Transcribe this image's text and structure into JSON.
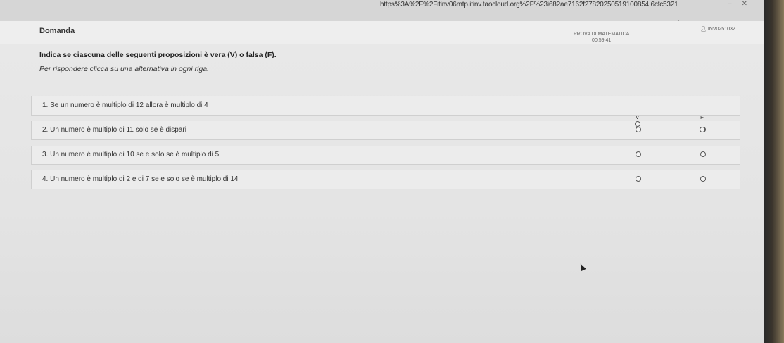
{
  "browser": {
    "url": "https%3A%2F%2Fitinv06mtp.itinv.taocloud.org%2F%23i682ae7162f27820250519100854 6cfc5321",
    "icons": [
      "reader-icon",
      "star-icon",
      "refresh-icon",
      "extension-icon",
      "settings-icon"
    ]
  },
  "header": {
    "title": "Domanda",
    "test_name": "PROVA DI MATEMATICA",
    "timer": "00:59:41",
    "user": "INV0251032"
  },
  "question": {
    "instruction": "Indica se ciascuna delle seguenti proposizioni è vera (V) o falsa (F).",
    "hint": "Per rispondere clicca su una alternativa in ogni riga.",
    "col_true": "V",
    "col_false": "F",
    "statements": [
      "1. Se un numero è multiplo di 12 allora è multiplo di 4",
      "2. Un numero è multiplo di 11 solo se è dispari",
      "3. Un numero è multiplo di 10 se e solo se è multiplo di 5",
      "4. Un numero è multiplo di 2 e di 7 se e solo se è multiplo di 14"
    ]
  }
}
